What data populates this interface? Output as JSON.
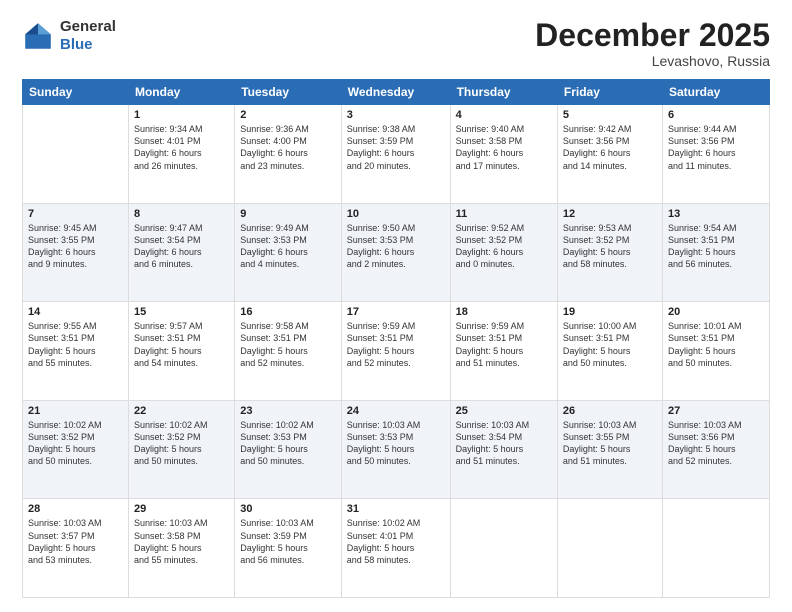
{
  "logo": {
    "general": "General",
    "blue": "Blue"
  },
  "header": {
    "month": "December 2025",
    "location": "Levashovo, Russia"
  },
  "days": [
    "Sunday",
    "Monday",
    "Tuesday",
    "Wednesday",
    "Thursday",
    "Friday",
    "Saturday"
  ],
  "weeks": [
    [
      {
        "day": "",
        "info": ""
      },
      {
        "day": "1",
        "info": "Sunrise: 9:34 AM\nSunset: 4:01 PM\nDaylight: 6 hours\nand 26 minutes."
      },
      {
        "day": "2",
        "info": "Sunrise: 9:36 AM\nSunset: 4:00 PM\nDaylight: 6 hours\nand 23 minutes."
      },
      {
        "day": "3",
        "info": "Sunrise: 9:38 AM\nSunset: 3:59 PM\nDaylight: 6 hours\nand 20 minutes."
      },
      {
        "day": "4",
        "info": "Sunrise: 9:40 AM\nSunset: 3:58 PM\nDaylight: 6 hours\nand 17 minutes."
      },
      {
        "day": "5",
        "info": "Sunrise: 9:42 AM\nSunset: 3:56 PM\nDaylight: 6 hours\nand 14 minutes."
      },
      {
        "day": "6",
        "info": "Sunrise: 9:44 AM\nSunset: 3:56 PM\nDaylight: 6 hours\nand 11 minutes."
      }
    ],
    [
      {
        "day": "7",
        "info": "Sunrise: 9:45 AM\nSunset: 3:55 PM\nDaylight: 6 hours\nand 9 minutes."
      },
      {
        "day": "8",
        "info": "Sunrise: 9:47 AM\nSunset: 3:54 PM\nDaylight: 6 hours\nand 6 minutes."
      },
      {
        "day": "9",
        "info": "Sunrise: 9:49 AM\nSunset: 3:53 PM\nDaylight: 6 hours\nand 4 minutes."
      },
      {
        "day": "10",
        "info": "Sunrise: 9:50 AM\nSunset: 3:53 PM\nDaylight: 6 hours\nand 2 minutes."
      },
      {
        "day": "11",
        "info": "Sunrise: 9:52 AM\nSunset: 3:52 PM\nDaylight: 6 hours\nand 0 minutes."
      },
      {
        "day": "12",
        "info": "Sunrise: 9:53 AM\nSunset: 3:52 PM\nDaylight: 5 hours\nand 58 minutes."
      },
      {
        "day": "13",
        "info": "Sunrise: 9:54 AM\nSunset: 3:51 PM\nDaylight: 5 hours\nand 56 minutes."
      }
    ],
    [
      {
        "day": "14",
        "info": "Sunrise: 9:55 AM\nSunset: 3:51 PM\nDaylight: 5 hours\nand 55 minutes."
      },
      {
        "day": "15",
        "info": "Sunrise: 9:57 AM\nSunset: 3:51 PM\nDaylight: 5 hours\nand 54 minutes."
      },
      {
        "day": "16",
        "info": "Sunrise: 9:58 AM\nSunset: 3:51 PM\nDaylight: 5 hours\nand 52 minutes."
      },
      {
        "day": "17",
        "info": "Sunrise: 9:59 AM\nSunset: 3:51 PM\nDaylight: 5 hours\nand 52 minutes."
      },
      {
        "day": "18",
        "info": "Sunrise: 9:59 AM\nSunset: 3:51 PM\nDaylight: 5 hours\nand 51 minutes."
      },
      {
        "day": "19",
        "info": "Sunrise: 10:00 AM\nSunset: 3:51 PM\nDaylight: 5 hours\nand 50 minutes."
      },
      {
        "day": "20",
        "info": "Sunrise: 10:01 AM\nSunset: 3:51 PM\nDaylight: 5 hours\nand 50 minutes."
      }
    ],
    [
      {
        "day": "21",
        "info": "Sunrise: 10:02 AM\nSunset: 3:52 PM\nDaylight: 5 hours\nand 50 minutes."
      },
      {
        "day": "22",
        "info": "Sunrise: 10:02 AM\nSunset: 3:52 PM\nDaylight: 5 hours\nand 50 minutes."
      },
      {
        "day": "23",
        "info": "Sunrise: 10:02 AM\nSunset: 3:53 PM\nDaylight: 5 hours\nand 50 minutes."
      },
      {
        "day": "24",
        "info": "Sunrise: 10:03 AM\nSunset: 3:53 PM\nDaylight: 5 hours\nand 50 minutes."
      },
      {
        "day": "25",
        "info": "Sunrise: 10:03 AM\nSunset: 3:54 PM\nDaylight: 5 hours\nand 51 minutes."
      },
      {
        "day": "26",
        "info": "Sunrise: 10:03 AM\nSunset: 3:55 PM\nDaylight: 5 hours\nand 51 minutes."
      },
      {
        "day": "27",
        "info": "Sunrise: 10:03 AM\nSunset: 3:56 PM\nDaylight: 5 hours\nand 52 minutes."
      }
    ],
    [
      {
        "day": "28",
        "info": "Sunrise: 10:03 AM\nSunset: 3:57 PM\nDaylight: 5 hours\nand 53 minutes."
      },
      {
        "day": "29",
        "info": "Sunrise: 10:03 AM\nSunset: 3:58 PM\nDaylight: 5 hours\nand 55 minutes."
      },
      {
        "day": "30",
        "info": "Sunrise: 10:03 AM\nSunset: 3:59 PM\nDaylight: 5 hours\nand 56 minutes."
      },
      {
        "day": "31",
        "info": "Sunrise: 10:02 AM\nSunset: 4:01 PM\nDaylight: 5 hours\nand 58 minutes."
      },
      {
        "day": "",
        "info": ""
      },
      {
        "day": "",
        "info": ""
      },
      {
        "day": "",
        "info": ""
      }
    ]
  ]
}
